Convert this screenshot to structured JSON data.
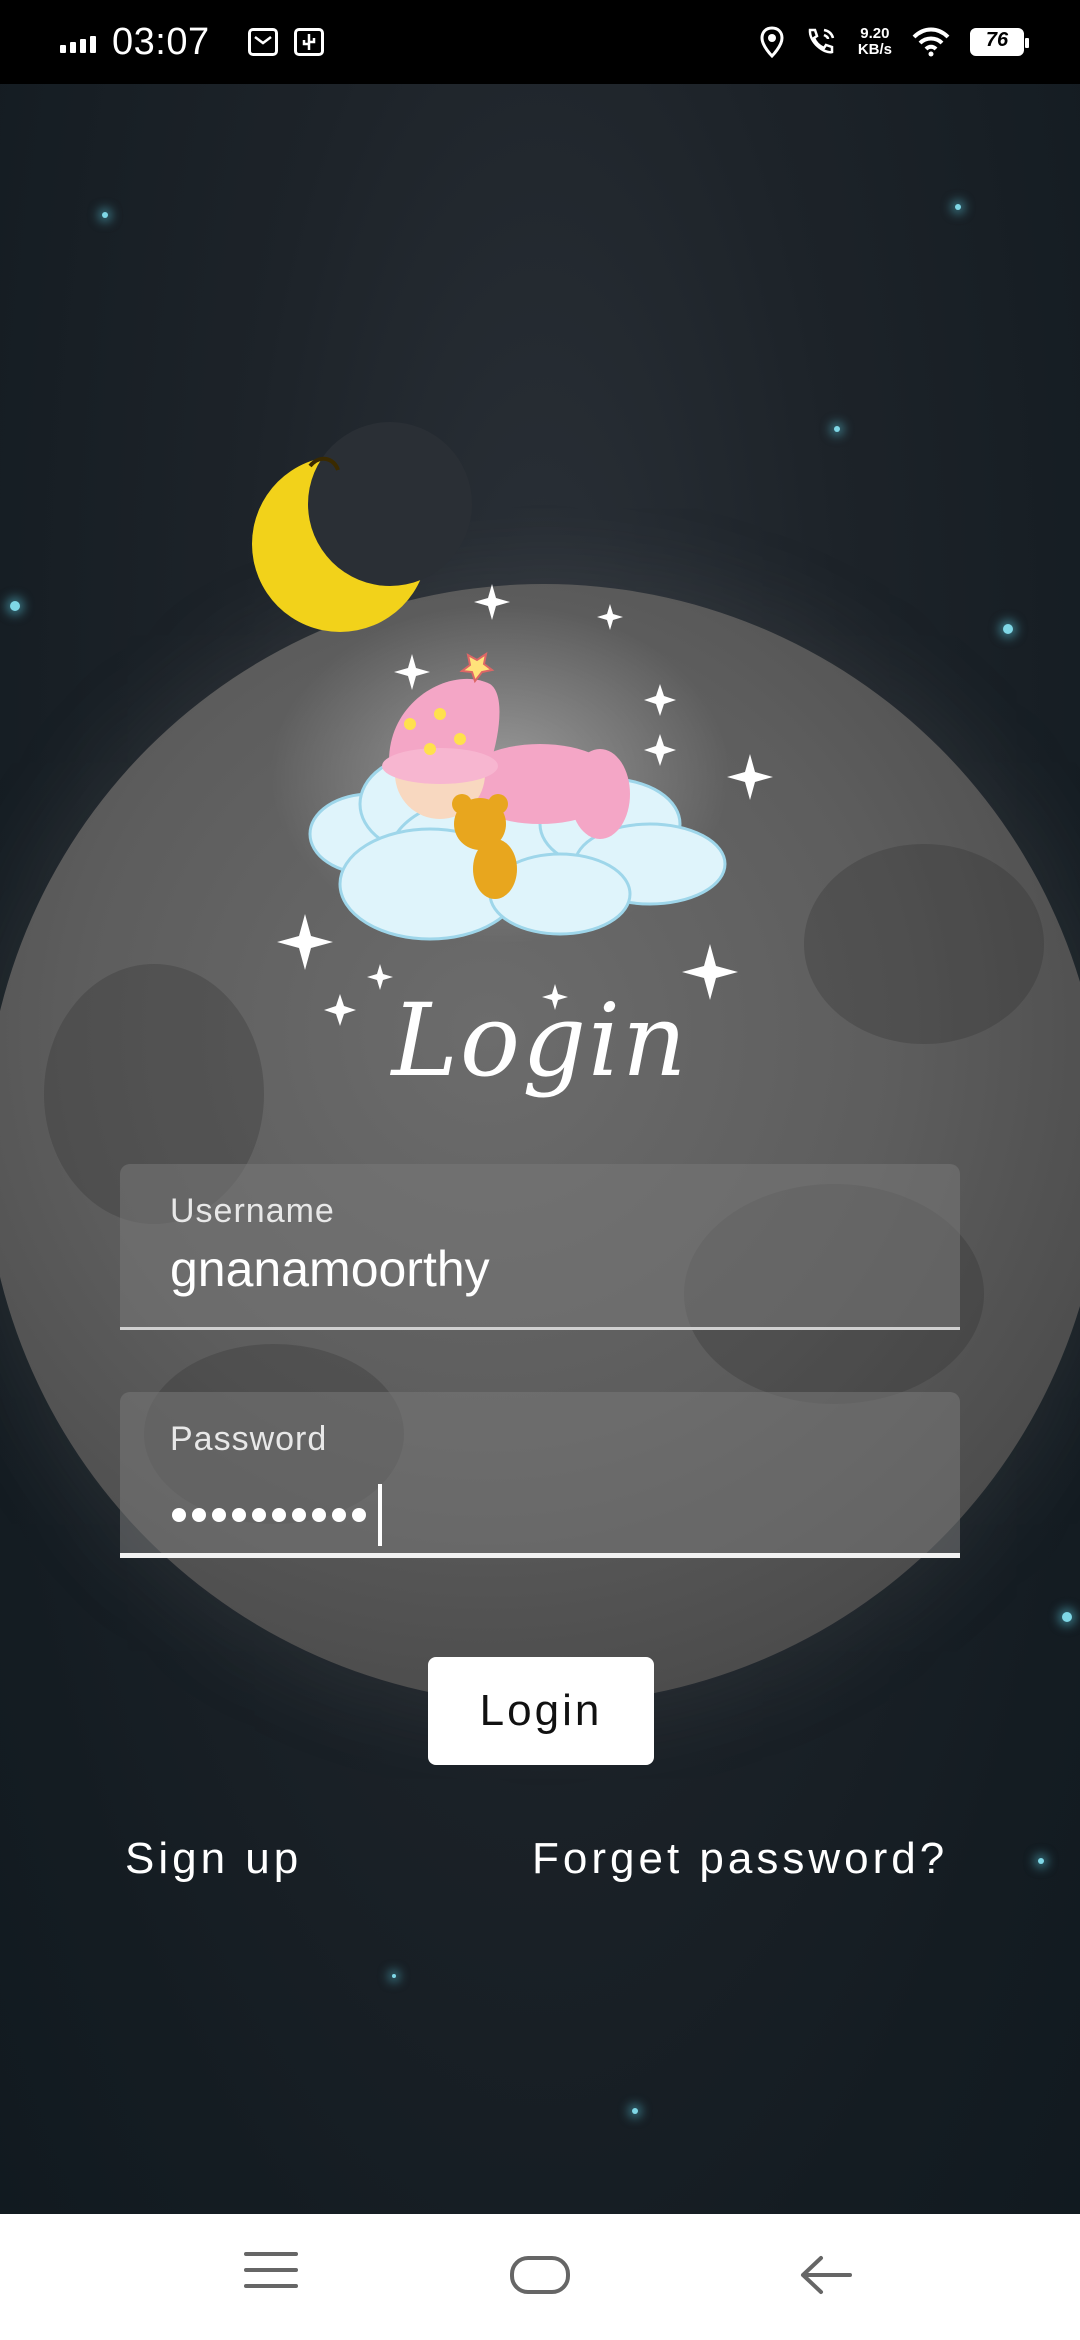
{
  "status_bar": {
    "time": "03:07",
    "speed_value": "9.20",
    "speed_unit": "KB/s",
    "battery": "76"
  },
  "screen": {
    "title": "Login",
    "username": {
      "label": "Username",
      "value": "gnanamoorthy"
    },
    "password": {
      "label": "Password",
      "masked_length": 10
    },
    "login_button": "Login",
    "sign_up": "Sign up",
    "forget_password": "Forget password?"
  },
  "nav": {
    "icons": [
      "menu-icon",
      "home-icon",
      "back-icon"
    ]
  }
}
